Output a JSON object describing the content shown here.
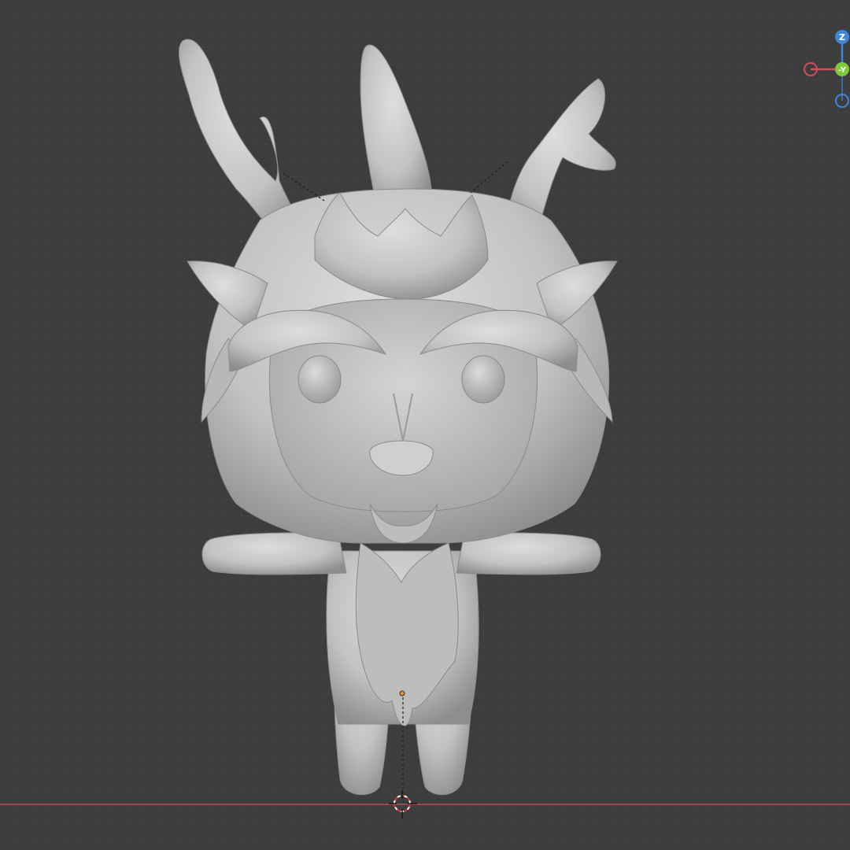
{
  "viewport": {
    "background": "#3d3d3d",
    "grid_color": "#474747",
    "floor_line_color": "#9a4a4e",
    "model_color": "#c7c7c7"
  },
  "gizmo": {
    "z_label": "Z",
    "y_label": "-Y",
    "colors": {
      "x": "#d44b5a",
      "y": "#7cc93a",
      "z": "#3d86dd"
    }
  },
  "icons": [
    "origin-point-icon",
    "3d-cursor-icon"
  ]
}
